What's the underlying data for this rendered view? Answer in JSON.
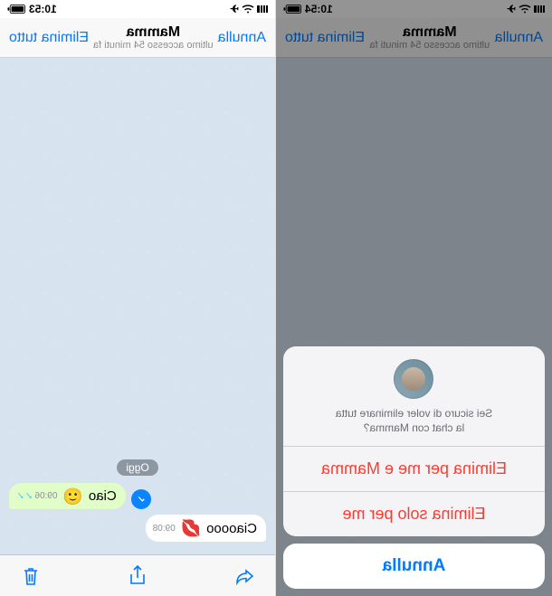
{
  "left": {
    "status": {
      "time": "10:54",
      "loc": "✈︎"
    },
    "nav": {
      "cancel": "Annulla",
      "title": "Mamma",
      "subtitle": "ultimo accesso 54 minuti fa",
      "action": "Elimina tutto"
    },
    "sheet": {
      "message_l1": "Sei sicuro di voler eliminare tutta",
      "message_l2": "la chat con Mamma?",
      "opt1": "Elimina per me e Mamma",
      "opt2": "Elimina solo per me",
      "cancel": "Annulla"
    }
  },
  "right": {
    "status": {
      "time": "10:53",
      "loc": "✈︎"
    },
    "nav": {
      "cancel": "Annulla",
      "title": "Mamma",
      "subtitle": "ultimo accesso 54 minuti fa",
      "action": "Elimina tutto"
    },
    "chat": {
      "date": "Oggi",
      "out": {
        "text": "Ciao",
        "emoji": "🙂",
        "time": "09:06"
      },
      "in": {
        "text": "Ciaoooo",
        "emoji": "💋",
        "time": "09:08"
      }
    }
  }
}
